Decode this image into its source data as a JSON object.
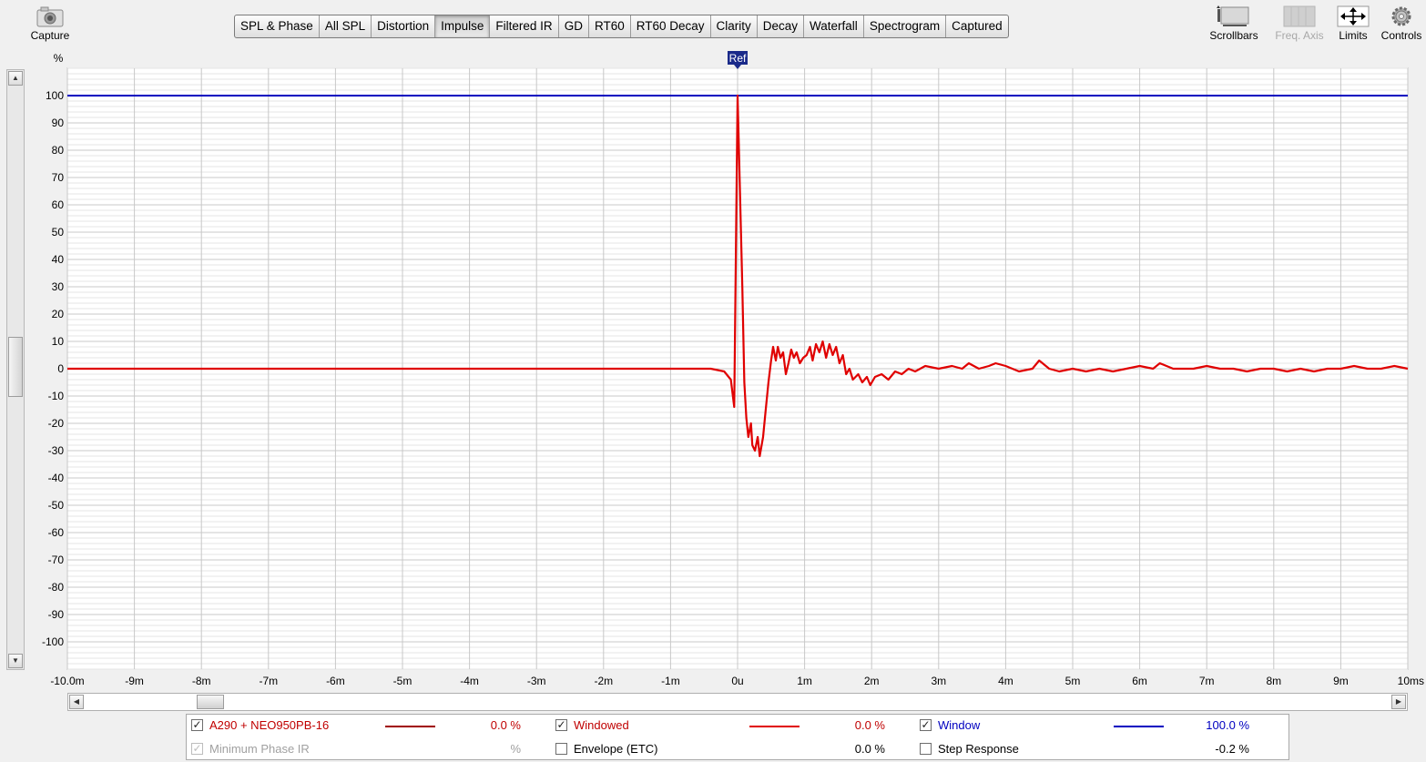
{
  "toolbar": {
    "capture_label": "Capture",
    "scrollbars_label": "Scrollbars",
    "freq_axis_label": "Freq. Axis",
    "limits_label": "Limits",
    "controls_label": "Controls"
  },
  "tabs": [
    {
      "label": "SPL & Phase",
      "active": false
    },
    {
      "label": "All SPL",
      "active": false
    },
    {
      "label": "Distortion",
      "active": false
    },
    {
      "label": "Impulse",
      "active": true
    },
    {
      "label": "Filtered IR",
      "active": false
    },
    {
      "label": "GD",
      "active": false
    },
    {
      "label": "RT60",
      "active": false
    },
    {
      "label": "RT60 Decay",
      "active": false
    },
    {
      "label": "Clarity",
      "active": false
    },
    {
      "label": "Decay",
      "active": false
    },
    {
      "label": "Waterfall",
      "active": false
    },
    {
      "label": "Spectrogram",
      "active": false
    },
    {
      "label": "Captured",
      "active": false
    }
  ],
  "chart_data": {
    "type": "line",
    "ylabel": "%",
    "ylim": [
      -110,
      110
    ],
    "xlim": [
      -10,
      10
    ],
    "x_unit": "ms",
    "y_ticks": [
      100,
      90,
      80,
      70,
      60,
      50,
      40,
      30,
      20,
      10,
      0,
      -10,
      -20,
      -30,
      -40,
      -50,
      -60,
      -70,
      -80,
      -90,
      -100
    ],
    "x_ticks": [
      {
        "x": -10,
        "label": "-10.0m"
      },
      {
        "x": -9,
        "label": "-9m"
      },
      {
        "x": -8,
        "label": "-8m"
      },
      {
        "x": -7,
        "label": "-7m"
      },
      {
        "x": -6,
        "label": "-6m"
      },
      {
        "x": -5,
        "label": "-5m"
      },
      {
        "x": -4,
        "label": "-4m"
      },
      {
        "x": -3,
        "label": "-3m"
      },
      {
        "x": -2,
        "label": "-2m"
      },
      {
        "x": -1,
        "label": "-1m"
      },
      {
        "x": 0,
        "label": "0u"
      },
      {
        "x": 1,
        "label": "1m"
      },
      {
        "x": 2,
        "label": "2m"
      },
      {
        "x": 3,
        "label": "3m"
      },
      {
        "x": 4,
        "label": "4m"
      },
      {
        "x": 5,
        "label": "5m"
      },
      {
        "x": 6,
        "label": "6m"
      },
      {
        "x": 7,
        "label": "7m"
      },
      {
        "x": 8,
        "label": "8m"
      },
      {
        "x": 9,
        "label": "9m"
      },
      {
        "x": 10,
        "label": "10ms"
      }
    ],
    "marker": {
      "label": "Ref",
      "x": 0
    },
    "grid": true,
    "series": [
      {
        "name": "Window",
        "color": "#0000c0",
        "points": [
          [
            -10,
            100
          ],
          [
            10,
            100
          ]
        ]
      },
      {
        "name": "A290 + NEO950PB-16",
        "color": "#e00000",
        "points": [
          [
            -10,
            0
          ],
          [
            -3,
            0
          ],
          [
            -0.4,
            0
          ],
          [
            -0.2,
            -1
          ],
          [
            -0.1,
            -4
          ],
          [
            -0.05,
            -14
          ],
          [
            0,
            100
          ],
          [
            0.07,
            30
          ],
          [
            0.1,
            -5
          ],
          [
            0.13,
            -18
          ],
          [
            0.16,
            -25
          ],
          [
            0.2,
            -20
          ],
          [
            0.22,
            -28
          ],
          [
            0.26,
            -30
          ],
          [
            0.3,
            -25
          ],
          [
            0.33,
            -32
          ],
          [
            0.38,
            -25
          ],
          [
            0.42,
            -15
          ],
          [
            0.46,
            -5
          ],
          [
            0.5,
            3
          ],
          [
            0.53,
            8
          ],
          [
            0.57,
            3
          ],
          [
            0.6,
            8
          ],
          [
            0.64,
            4
          ],
          [
            0.68,
            6
          ],
          [
            0.72,
            -2
          ],
          [
            0.76,
            2
          ],
          [
            0.8,
            7
          ],
          [
            0.84,
            4
          ],
          [
            0.88,
            6
          ],
          [
            0.93,
            2
          ],
          [
            0.98,
            4
          ],
          [
            1.03,
            5
          ],
          [
            1.08,
            8
          ],
          [
            1.12,
            3
          ],
          [
            1.17,
            9
          ],
          [
            1.22,
            6
          ],
          [
            1.27,
            10
          ],
          [
            1.32,
            4
          ],
          [
            1.37,
            9
          ],
          [
            1.42,
            5
          ],
          [
            1.47,
            8
          ],
          [
            1.52,
            2
          ],
          [
            1.57,
            5
          ],
          [
            1.62,
            -2
          ],
          [
            1.67,
            0
          ],
          [
            1.72,
            -4
          ],
          [
            1.8,
            -2
          ],
          [
            1.86,
            -5
          ],
          [
            1.93,
            -3
          ],
          [
            1.98,
            -6
          ],
          [
            2.05,
            -3
          ],
          [
            2.15,
            -2
          ],
          [
            2.25,
            -4
          ],
          [
            2.35,
            -1
          ],
          [
            2.45,
            -2
          ],
          [
            2.55,
            0
          ],
          [
            2.65,
            -1
          ],
          [
            2.8,
            1
          ],
          [
            3.0,
            0
          ],
          [
            3.2,
            1
          ],
          [
            3.35,
            0
          ],
          [
            3.45,
            2
          ],
          [
            3.6,
            0
          ],
          [
            3.75,
            1
          ],
          [
            3.85,
            2
          ],
          [
            4.0,
            1
          ],
          [
            4.2,
            -1
          ],
          [
            4.4,
            0
          ],
          [
            4.5,
            3
          ],
          [
            4.65,
            0
          ],
          [
            4.8,
            -1
          ],
          [
            5.0,
            0
          ],
          [
            5.2,
            -1
          ],
          [
            5.4,
            0
          ],
          [
            5.6,
            -1
          ],
          [
            5.8,
            0
          ],
          [
            6.0,
            1
          ],
          [
            6.2,
            0
          ],
          [
            6.3,
            2
          ],
          [
            6.5,
            0
          ],
          [
            6.8,
            0
          ],
          [
            7.0,
            1
          ],
          [
            7.2,
            0
          ],
          [
            7.4,
            0
          ],
          [
            7.6,
            -1
          ],
          [
            7.8,
            0
          ],
          [
            8.0,
            0
          ],
          [
            8.2,
            -1
          ],
          [
            8.4,
            0
          ],
          [
            8.6,
            -1
          ],
          [
            8.8,
            0
          ],
          [
            9.0,
            0
          ],
          [
            9.2,
            1
          ],
          [
            9.4,
            0
          ],
          [
            9.6,
            0
          ],
          [
            9.8,
            1
          ],
          [
            10.0,
            0
          ]
        ]
      }
    ]
  },
  "legend": {
    "rows": [
      [
        {
          "label": "A290 + NEO950PB-16",
          "checked": true,
          "enabled": true,
          "color": "#c00000",
          "line_color": "#a00000",
          "value": "0.0 %"
        },
        {
          "label": "Windowed",
          "checked": true,
          "enabled": true,
          "color": "#c00000",
          "line_color": "#e00000",
          "value": "0.0 %"
        },
        {
          "label": "Window",
          "checked": true,
          "enabled": true,
          "color": "#0000c0",
          "line_color": "#0000c0",
          "value": "100.0 %"
        }
      ],
      [
        {
          "label": "Minimum Phase IR",
          "checked": true,
          "enabled": false,
          "color": "#a0a0a0",
          "line_color": "",
          "value": "%"
        },
        {
          "label": "Envelope (ETC)",
          "checked": false,
          "enabled": true,
          "color": "#000000",
          "line_color": "",
          "value": "0.0 %"
        },
        {
          "label": "Step Response",
          "checked": false,
          "enabled": true,
          "color": "#000000",
          "line_color": "",
          "value": "-0.2 %"
        }
      ]
    ]
  },
  "colors": {
    "plot_bg": "#ffffff",
    "grid_major": "#c8c8c8",
    "grid_minor": "#e4e4e4",
    "marker_bg": "#1a2a8a"
  }
}
